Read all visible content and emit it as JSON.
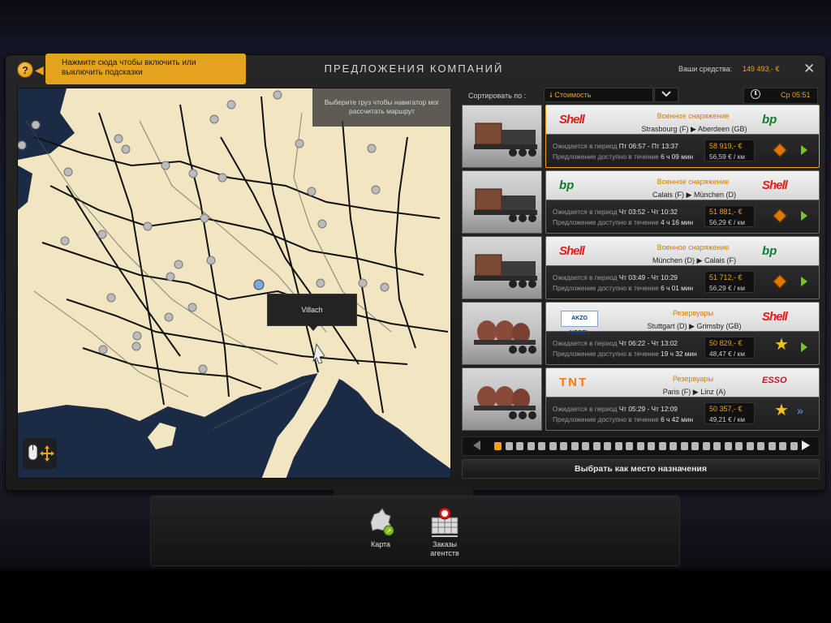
{
  "header": {
    "help_hint": "Нажмите сюда чтобы включить или выключить подсказки",
    "title": "ПРЕДЛОЖЕНИЯ КОМПАНИЙ",
    "funds_label": "Ваши средства:",
    "funds_value": "149 493,- €",
    "close": "✕"
  },
  "map": {
    "hint": "Выберите груз чтобы навигатор мог рассчитать маршрут",
    "tooltip_city": "Villach"
  },
  "sort": {
    "label": "Сортировать по :",
    "selected": "🠗 Стоимость",
    "time": "Ср 05:51"
  },
  "offers": [
    {
      "cargo": "Военное снаряжение",
      "route": "Strasbourg (F) ▶ Aberdeen (GB)",
      "period_label": "Ожидается в период",
      "period_value": "Пт 06:57 - Пт 13:37",
      "avail_label": "Предложение доступно в течение",
      "avail_value": "6 ч 09 мин",
      "pay": "58 919,- €",
      "per_km": "56,59 € / км",
      "from_logo": "Shell",
      "to_logo": "bp",
      "icon": "hazard-icon",
      "action": "play-icon"
    },
    {
      "cargo": "Военное снаряжение",
      "route": "Calais (F) ▶ München (D)",
      "period_label": "Ожидается в период",
      "period_value": "Чт 03:52 - Чт 10:32",
      "avail_label": "Предложение доступно в течение",
      "avail_value": "4 ч 16 мин",
      "pay": "51 881,- €",
      "per_km": "56,29 € / км",
      "from_logo": "bp",
      "to_logo": "Shell",
      "icon": "hazard-icon",
      "action": "play-icon"
    },
    {
      "cargo": "Военное снаряжение",
      "route": "München (D) ▶ Calais (F)",
      "period_label": "Ожидается в период",
      "period_value": "Чт 03:49 - Чт 10:29",
      "avail_label": "Предложение доступно в течение",
      "avail_value": "6 ч 01 мин",
      "pay": "51 712,- €",
      "per_km": "56,29 € / км",
      "from_logo": "Shell",
      "to_logo": "bp",
      "icon": "hazard-icon",
      "action": "play-icon"
    },
    {
      "cargo": "Резервуары",
      "route": "Stuttgart (D) ▶ Grimsby (GB)",
      "period_label": "Ожидается в период",
      "period_value": "Чт 06:22 - Чт 13:02",
      "avail_label": "Предложение доступно в течение",
      "avail_value": "19 ч 32 мин",
      "pay": "50 829,- €",
      "per_km": "48,47 € / км",
      "from_logo": "AKZO NOBEL",
      "to_logo": "Shell",
      "icon": "star-icon",
      "action": "play-icon"
    },
    {
      "cargo": "Резервуары",
      "route": "Paris (F) ▶ Linz (A)",
      "period_label": "Ожидается в период",
      "period_value": "Чт 05:29 - Чт 12:09",
      "avail_label": "Предложение доступно в течение",
      "avail_value": "6 ч 42 мин",
      "pay": "50 357,- €",
      "per_km": "49,21 € / км",
      "from_logo": "TNT",
      "to_logo": "ESSO",
      "icon": "star-icon",
      "action": "fast-forward-icon"
    }
  ],
  "pager": {
    "active": 0
  },
  "select_destination": "Выбрать как место назначения",
  "bottom": {
    "map_label": "Карта",
    "agency_label": "Заказы агентств"
  },
  "colors": {
    "accent": "#f0a21a",
    "map_land": "#f1e6c1",
    "map_sea": "#1b2b45"
  }
}
